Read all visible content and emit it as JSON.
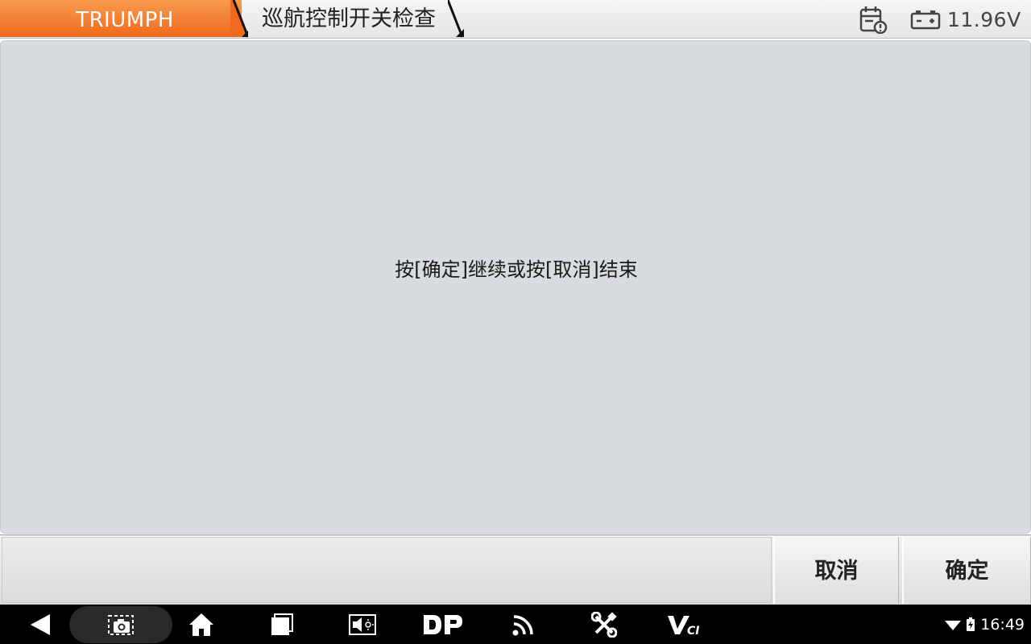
{
  "header": {
    "brand": "TRIUMPH",
    "breadcrumb": "巡航控制开关检查",
    "voltage": "11.96V",
    "icons": [
      "calendar-alert-icon",
      "battery-icon"
    ],
    "accent_color": "#ef6a1c"
  },
  "main": {
    "message": "按[确定]继续或按[取消]结束"
  },
  "actions": {
    "cancel_label": "取消",
    "ok_label": "确定"
  },
  "navbar": {
    "icons": [
      "back-icon",
      "screenshot-icon",
      "home-icon",
      "recents-icon",
      "volume-icon",
      "dp-icon",
      "wifi-signal-icon",
      "tools-icon",
      "vci-icon"
    ],
    "dp_label": "DP",
    "vci_label": "VCI",
    "time": "16:49"
  }
}
